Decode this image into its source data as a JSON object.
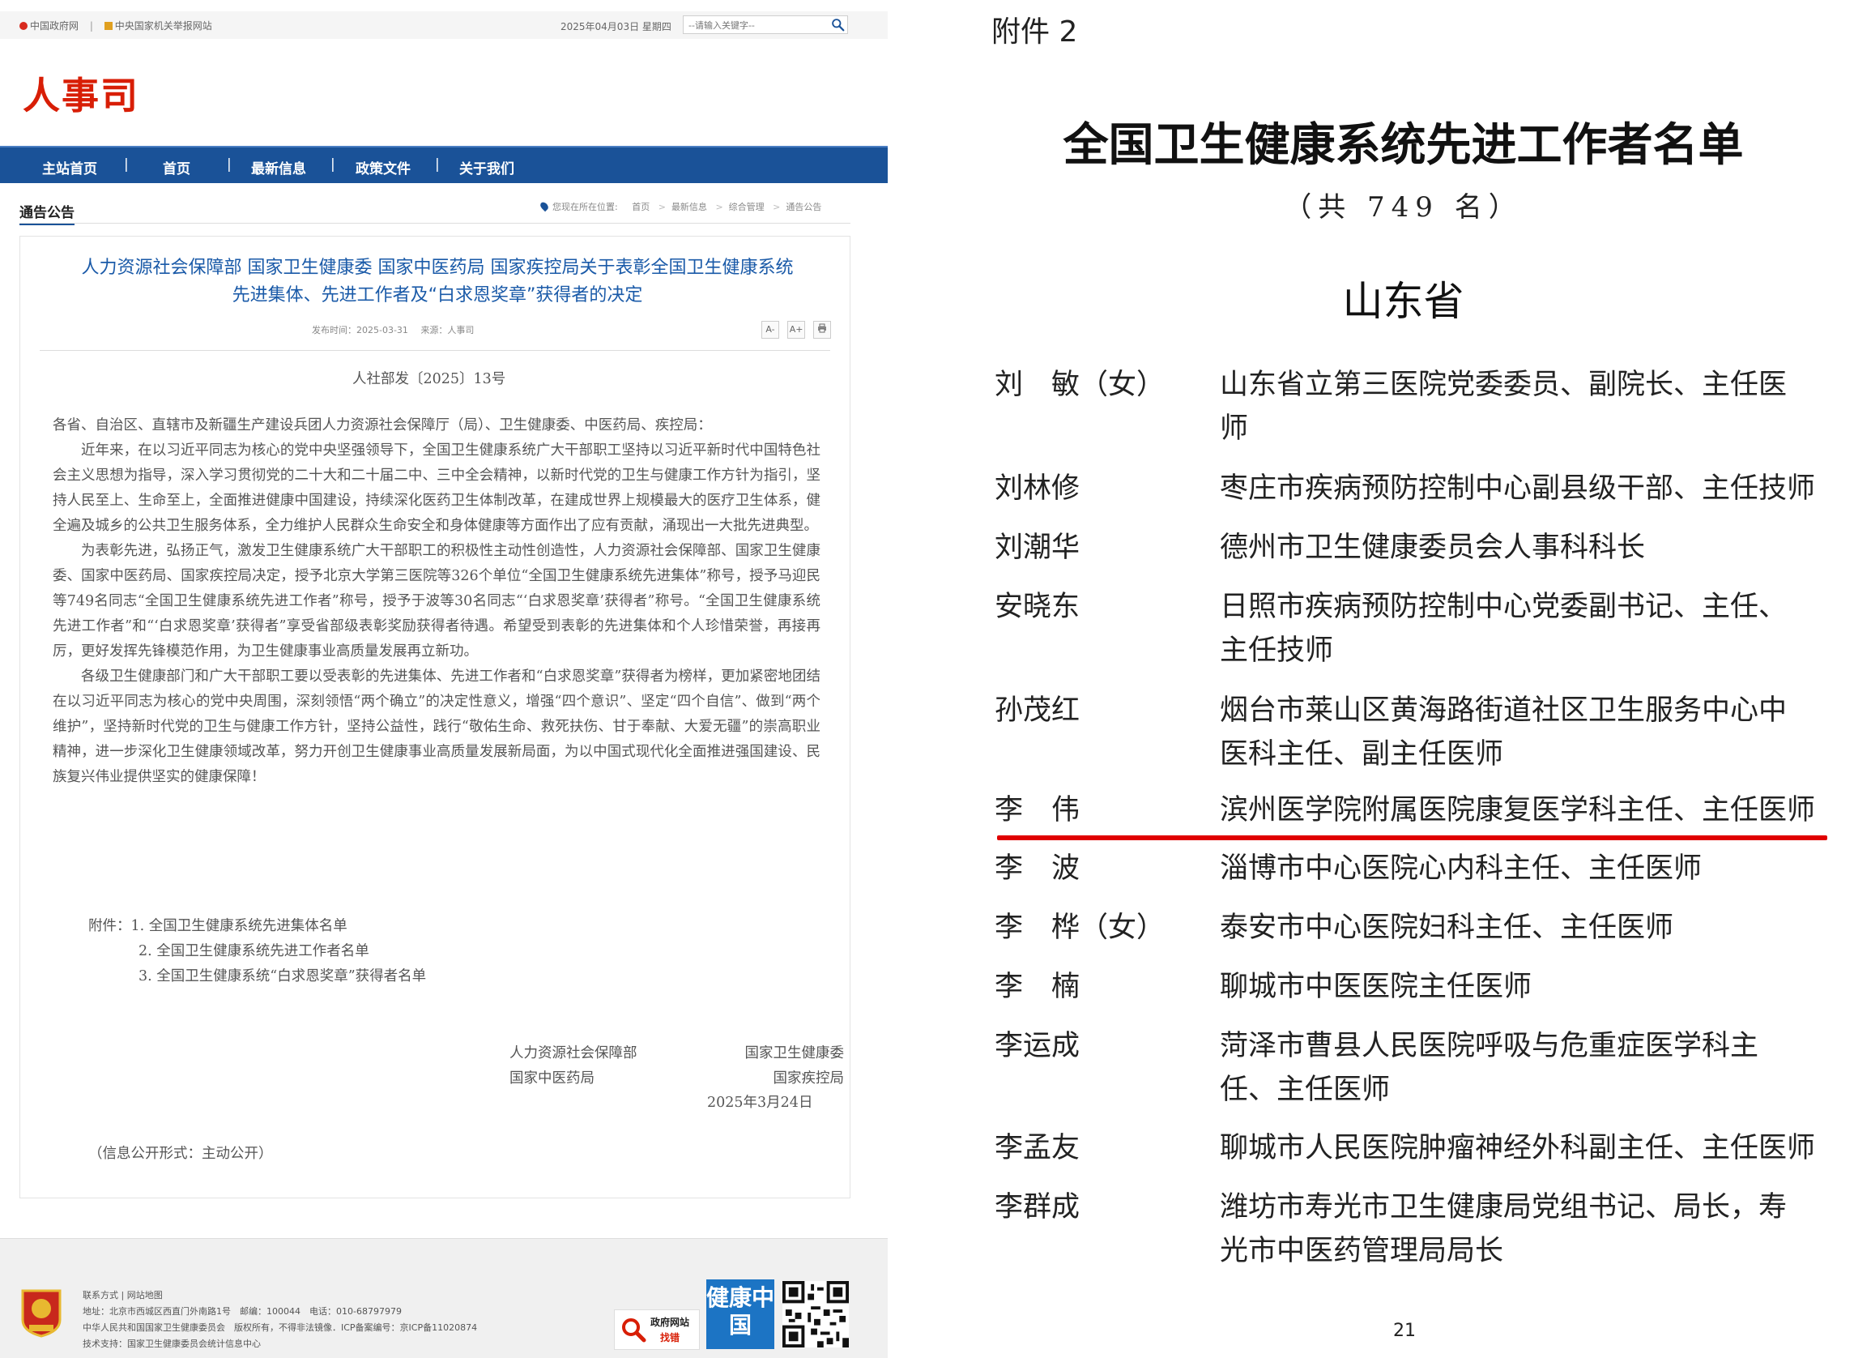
{
  "top_links": {
    "gov": "中国政府网",
    "report": "中央国家机关举报网站"
  },
  "date": "2025年04月03日 星期四",
  "search": {
    "placeholder": "--请输入关键字--"
  },
  "site_title": "人事司",
  "nav": [
    "主站首页",
    "首页",
    "最新信息",
    "政策文件",
    "关于我们"
  ],
  "section_title": "通告公告",
  "breadcrumb": {
    "label": "您现在所在位置:",
    "items": [
      "首页",
      "最新信息",
      "综合管理",
      "通告公告"
    ]
  },
  "article": {
    "title_line1": "人力资源社会保障部 国家卫生健康委 国家中医药局 国家疾控局关于表彰全国卫生健康系统",
    "title_line2": "先进集体、先进工作者及“白求恩奖章”获得者的决定",
    "publish_time": "发布时间：2025-03-31",
    "source": "来源：人事司",
    "tools": [
      "A-",
      "A+",
      "print"
    ],
    "doc_no": "人社部发〔2025〕13号",
    "salutation": "各省、自治区、直辖市及新疆生产建设兵团人力资源社会保障厅（局）、卫生健康委、中医药局、疾控局：",
    "para1": "近年来，在以习近平同志为核心的党中央坚强领导下，全国卫生健康系统广大干部职工坚持以习近平新时代中国特色社会主义思想为指导，深入学习贯彻党的二十大和二十届二中、三中全会精神，以新时代党的卫生与健康工作方针为指引，坚持人民至上、生命至上，全面推进健康中国建设，持续深化医药卫生体制改革，在建成世界上规模最大的医疗卫生体系，健全遍及城乡的公共卫生服务体系，全力维护人民群众生命安全和身体健康等方面作出了应有贡献，涌现出一大批先进典型。",
    "para2": "为表彰先进，弘扬正气，激发卫生健康系统广大干部职工的积极性主动性创造性，人力资源社会保障部、国家卫生健康委、国家中医药局、国家疾控局决定，授予北京大学第三医院等326个单位“全国卫生健康系统先进集体”称号，授予马迎民等749名同志“全国卫生健康系统先进工作者”称号，授予于波等30名同志“‘白求恩奖章’获得者”称号。“全国卫生健康系统先进工作者”和“‘白求恩奖章’获得者”享受省部级表彰奖励获得者待遇。希望受到表彰的先进集体和个人珍惜荣誉，再接再厉，更好发挥先锋模范作用，为卫生健康事业高质量发展再立新功。",
    "para3": "各级卫生健康部门和广大干部职工要以受表彰的先进集体、先进工作者和“白求恩奖章”获得者为榜样，更加紧密地团结在以习近平同志为核心的党中央周围，深刻领悟“两个确立”的决定性意义，增强“四个意识”、坚定“四个自信”、做到“两个维护”，坚持新时代党的卫生与健康工作方针，坚持公益性，践行“敬佑生命、救死扶伤、甘于奉献、大爱无疆”的崇高职业精神，进一步深化卫生健康领域改革，努力开创卫生健康事业高质量发展新局面，为以中国式现代化全面推进强国建设、民族复兴伟业提供坚实的健康保障！",
    "attachments_label": "附件：",
    "attachments": [
      "1. 全国卫生健康系统先进集体名单",
      "2. 全国卫生健康系统先进工作者名单",
      "3. 全国卫生健康系统“白求恩奖章”获得者名单"
    ],
    "signers_left": [
      "人力资源社会保障部",
      "国家中医药局"
    ],
    "signers_right": [
      "国家卫生健康委",
      "国家疾控局"
    ],
    "sign_date": "2025年3月24日",
    "disclosure": "（信息公开形式：主动公开）"
  },
  "footer": {
    "links": "联系方式 | 网站地图",
    "address": "地址：北京市西城区西直门外南路1号　邮编：100044　电话：010-68797979",
    "copyright": "中华人民共和国国家卫生健康委员会　版权所有，不得非法镜像．ICP备案编号：京ICP备11020874",
    "support": "技术支持：国家卫生健康委员会统计信息中心",
    "gov_badge": [
      "政府网站",
      "找错"
    ],
    "jk_badge": "健康中国",
    "emblem_label": "党政机关"
  },
  "right_doc": {
    "attachment_label": "附件 2",
    "title": "全国卫生健康系统先进工作者名单",
    "count": "（共 749 名）",
    "province": "山东省",
    "entries": [
      {
        "name": "刘　敏（女）",
        "desc": "山东省立第三医院党委委员、副院长、主任医师"
      },
      {
        "name": "刘林修",
        "desc": "枣庄市疾病预防控制中心副县级干部、主任技师"
      },
      {
        "name": "刘潮华",
        "desc": "德州市卫生健康委员会人事科科长"
      },
      {
        "name": "安晓东",
        "desc": "日照市疾病预防控制中心党委副书记、主任、主任技师"
      },
      {
        "name": "孙茂红",
        "desc": "烟台市莱山区黄海路街道社区卫生服务中心中医科主任、副主任医师"
      },
      {
        "name": "李　伟",
        "desc": "滨州医学院附属医院康复医学科主任、主任医师"
      },
      {
        "name": "李　波",
        "desc": "淄博市中心医院心内科主任、主任医师"
      },
      {
        "name": "李　桦（女）",
        "desc": "泰安市中心医院妇科主任、主任医师"
      },
      {
        "name": "李　楠",
        "desc": "聊城市中医医院主任医师"
      },
      {
        "name": "李运成",
        "desc": "菏泽市曹县人民医院呼吸与危重症医学科主任、主任医师"
      },
      {
        "name": "李孟友",
        "desc": "聊城市人民医院肿瘤神经外科副主任、主任医师"
      },
      {
        "name": "李群成",
        "desc": "潍坊市寿光市卫生健康局党组书记、局长，寿光市中医药管理局局长"
      }
    ],
    "page_number": "21"
  },
  "colors": {
    "nav_blue": "#1a5298",
    "brand_red": "#d81e06",
    "title_blue": "#1a5aa8",
    "highlight_red": "#e00000"
  }
}
